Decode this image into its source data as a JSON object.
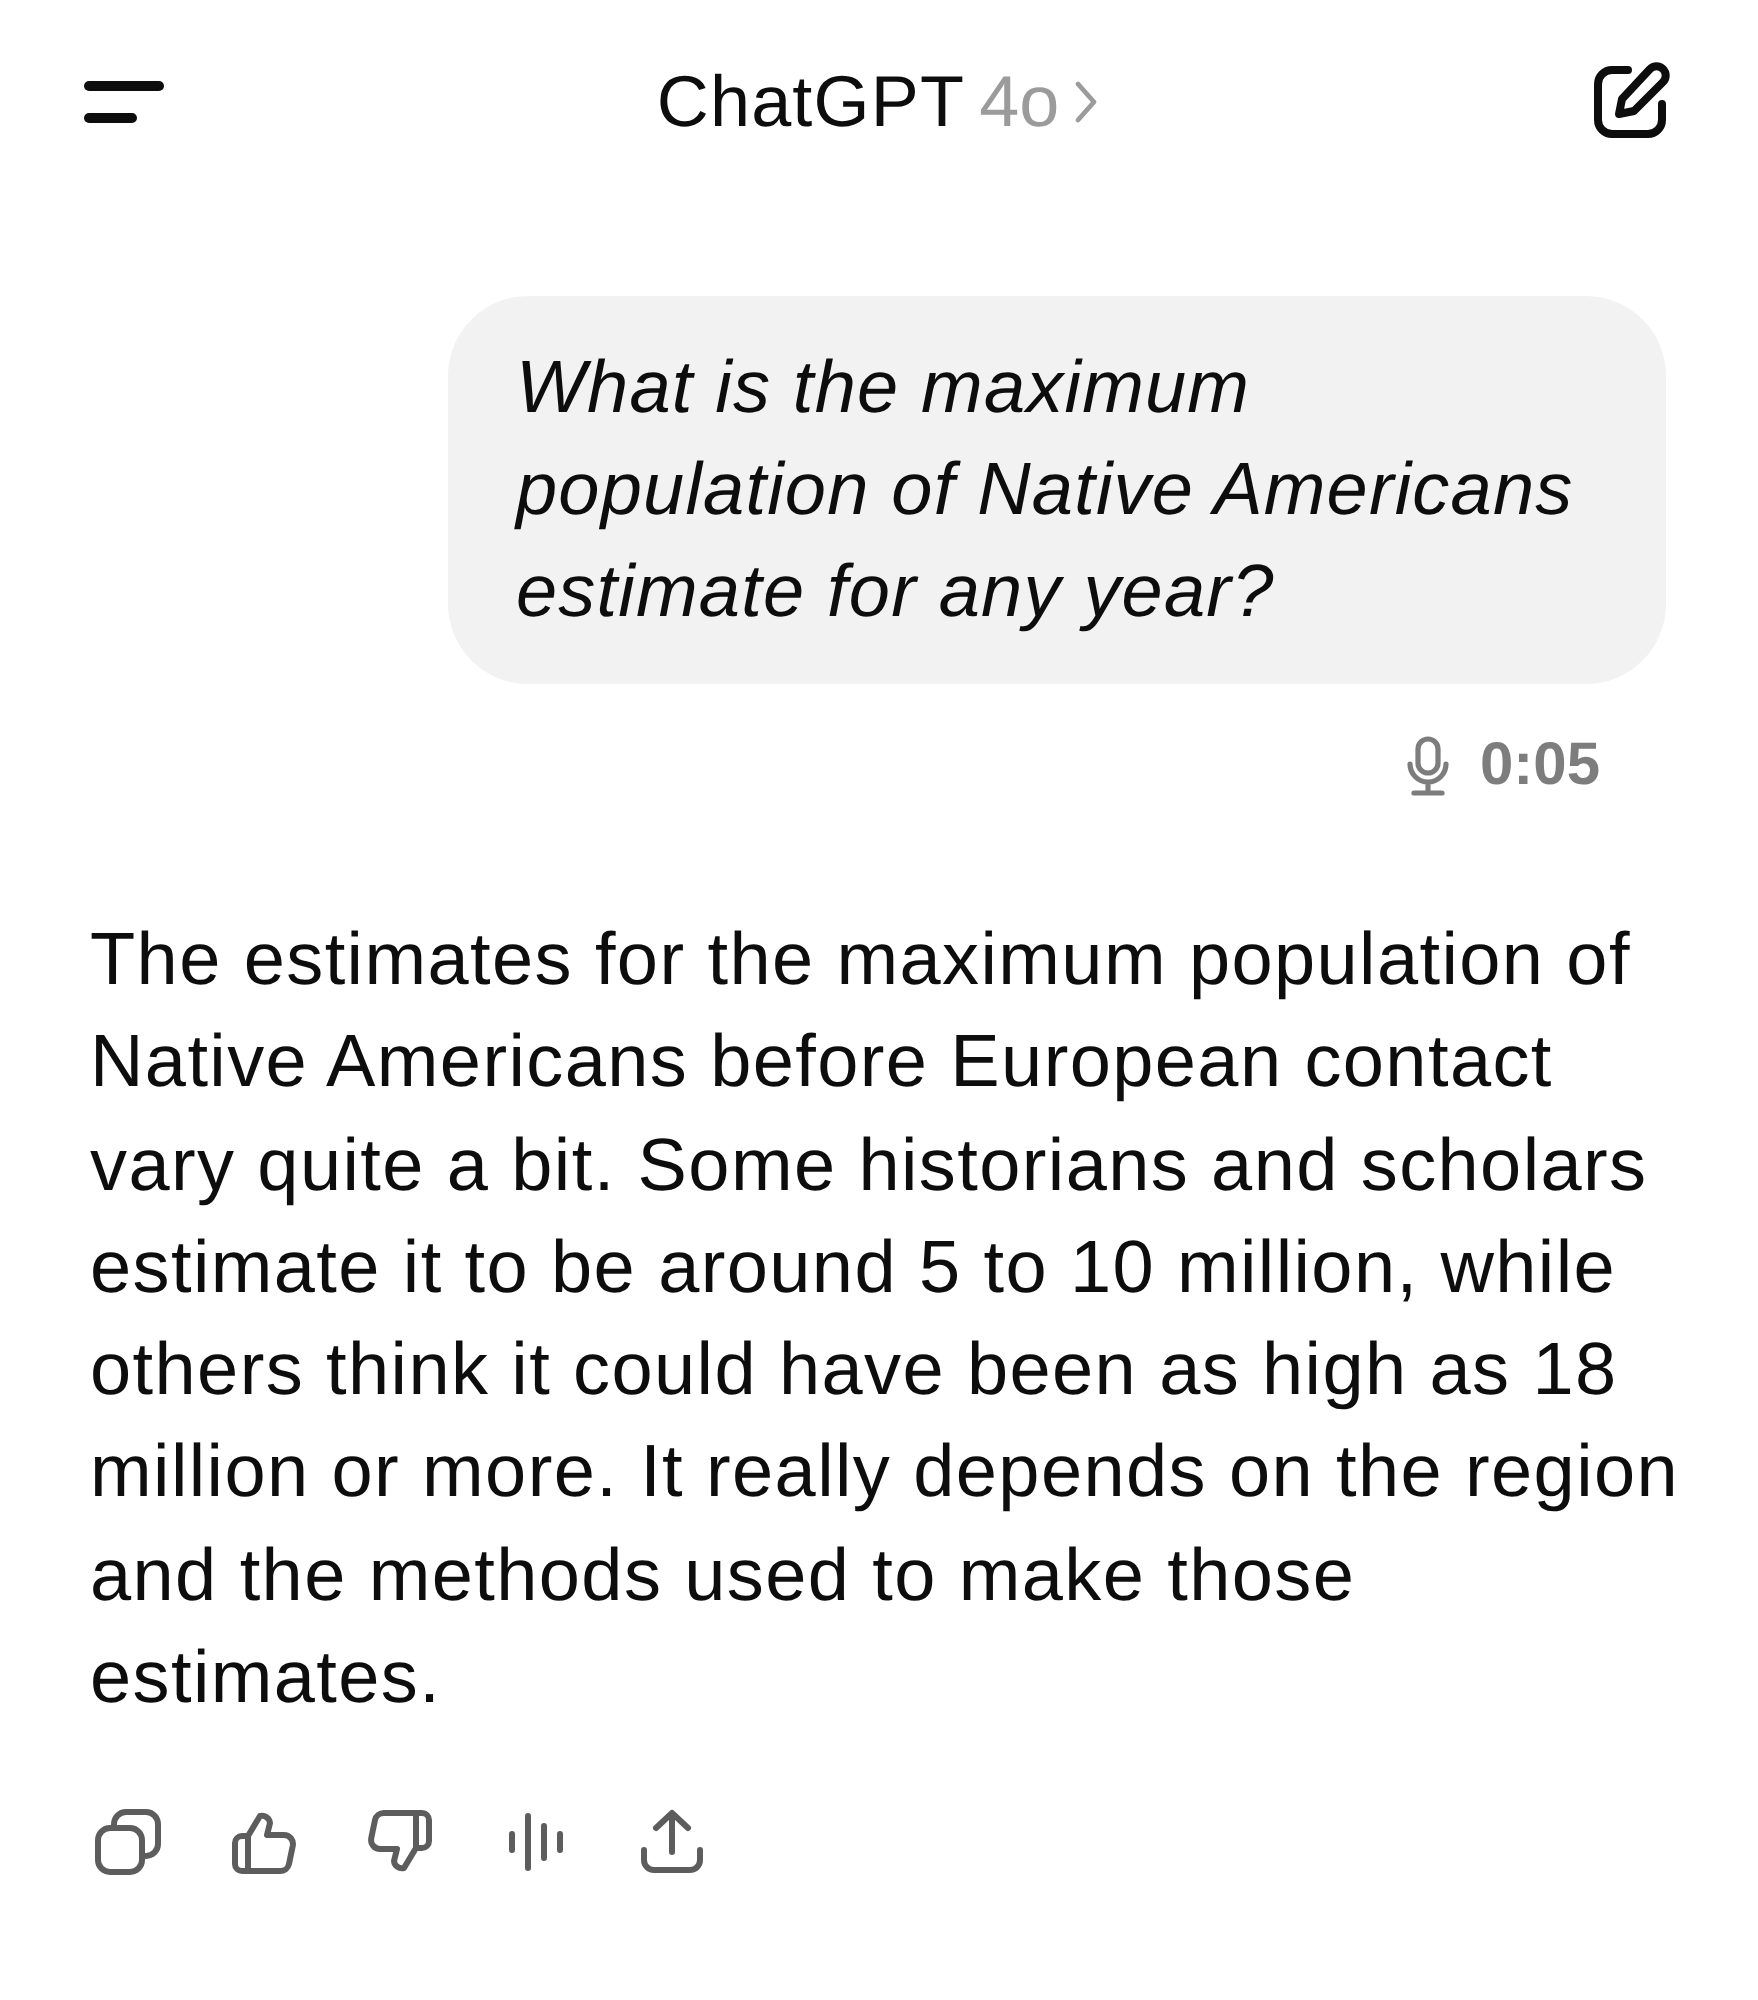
{
  "header": {
    "title": "ChatGPT",
    "model": "4o"
  },
  "user_message": {
    "text": "What is the maximum population of Native Americans estimate for any year?",
    "voice_duration": "0:05"
  },
  "assistant_message": {
    "text": "The estimates for the maximum population of Native Americans before European contact vary quite a bit. Some historians and scholars estimate it to be around 5 to 10 million, while others think it could have been as high as 18 million or more. It really depends on the region and the methods used to make those estimates."
  }
}
